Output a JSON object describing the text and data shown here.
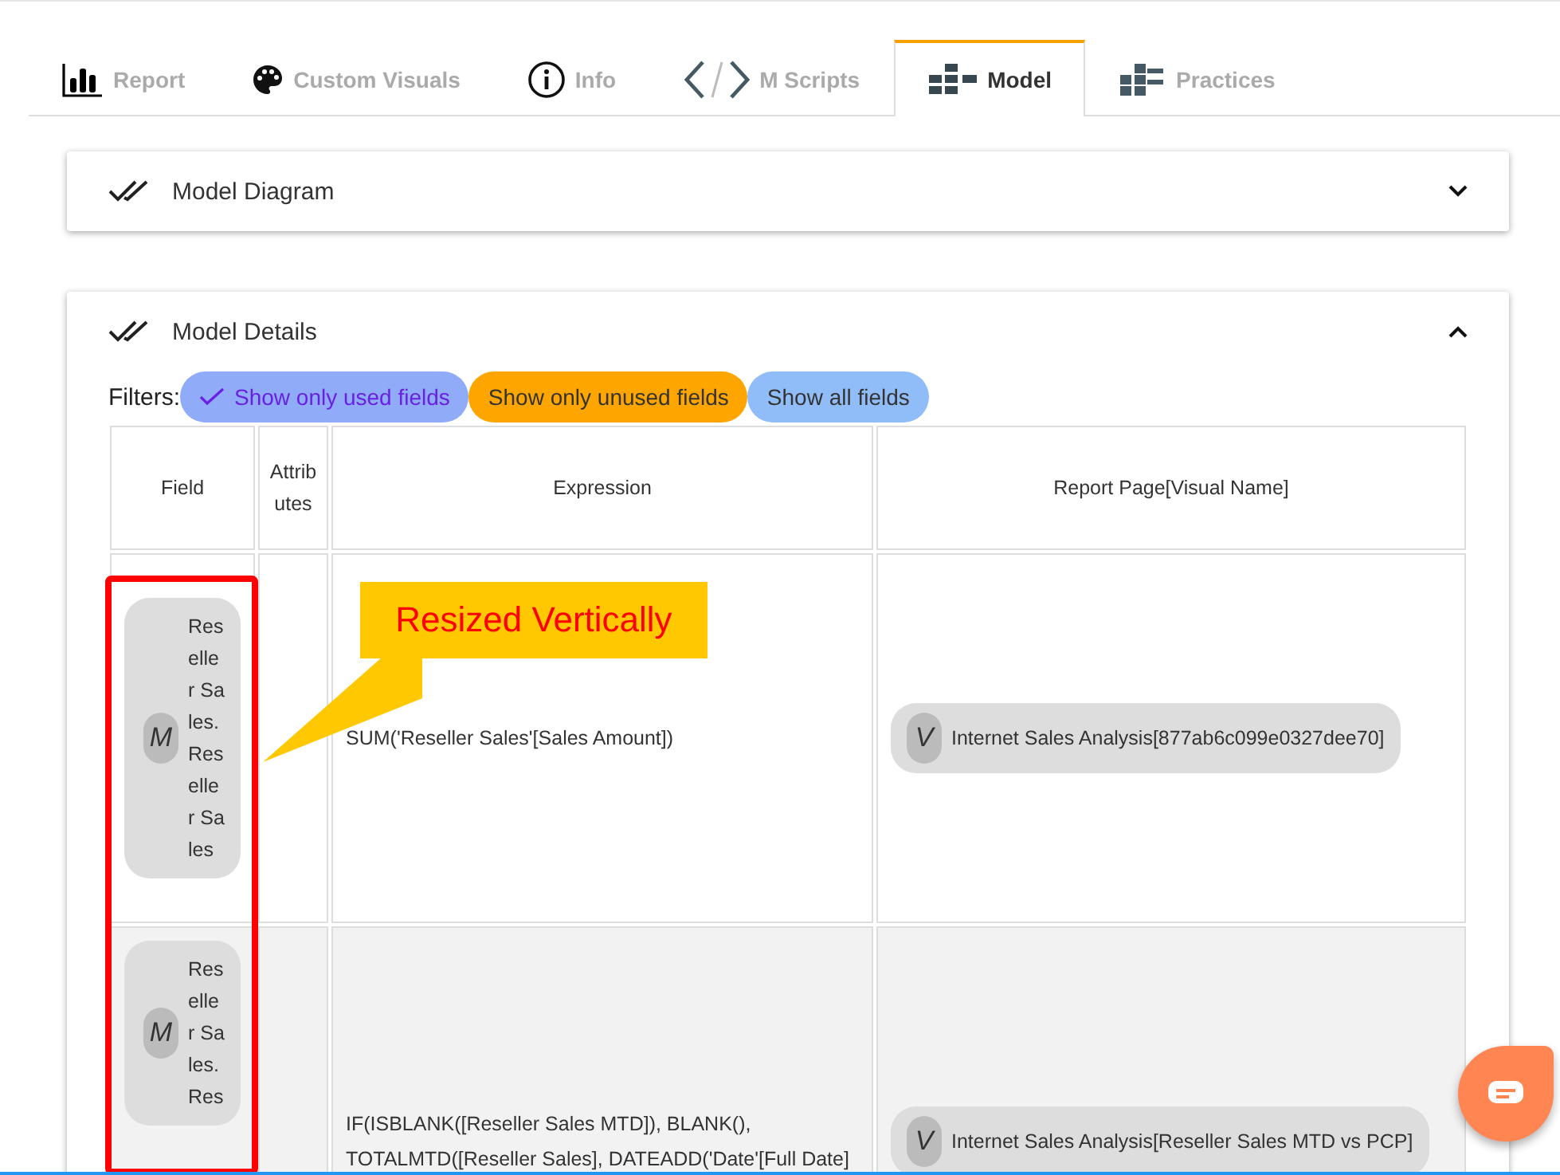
{
  "tabs": [
    {
      "label": "Report",
      "selected": false
    },
    {
      "label": "Custom Visuals",
      "selected": false
    },
    {
      "label": "Info",
      "selected": false
    },
    {
      "label": "M Scripts",
      "selected": false
    },
    {
      "label": "Model",
      "selected": true
    },
    {
      "label": "Practices",
      "selected": false
    }
  ],
  "sections": [
    {
      "title": "Model Diagram",
      "expanded": false
    },
    {
      "title": "Model Details",
      "expanded": true
    }
  ],
  "filters": {
    "label": "Filters:",
    "options": [
      {
        "label": "Show only used fields",
        "selected": true,
        "color": "#90acf8"
      },
      {
        "label": "Show only unused fields",
        "selected": false,
        "color": "#ffa500"
      },
      {
        "label": "Show all fields",
        "selected": false,
        "color": "#90bdf8"
      }
    ]
  },
  "table": {
    "columns": [
      "Field",
      "Attributes",
      "Expression",
      "Report Page[Visual Name]"
    ],
    "rows": [
      {
        "field": {
          "badge": "M",
          "name": "Reseller Sales. Reseller Sales"
        },
        "expression": "SUM('Reseller Sales'[Sales Amount])",
        "visuals": [
          {
            "badge": "V",
            "name": "Internet Sales Analysis[877ab6c099e0327dee70]"
          }
        ]
      },
      {
        "field": {
          "badge": "M",
          "name": "Reseller Sales. Res"
        },
        "expression": "IF(ISBLANK([Reseller Sales MTD]), BLANK(), TOTALMTD([Reseller Sales], DATEADD('Date'[Full Date]",
        "visuals": [
          {
            "badge": "V",
            "name": "Internet Sales Analysis[Reseller Sales MTD vs PCP]"
          }
        ]
      }
    ]
  },
  "annotation": {
    "text": "Resized Vertically"
  }
}
